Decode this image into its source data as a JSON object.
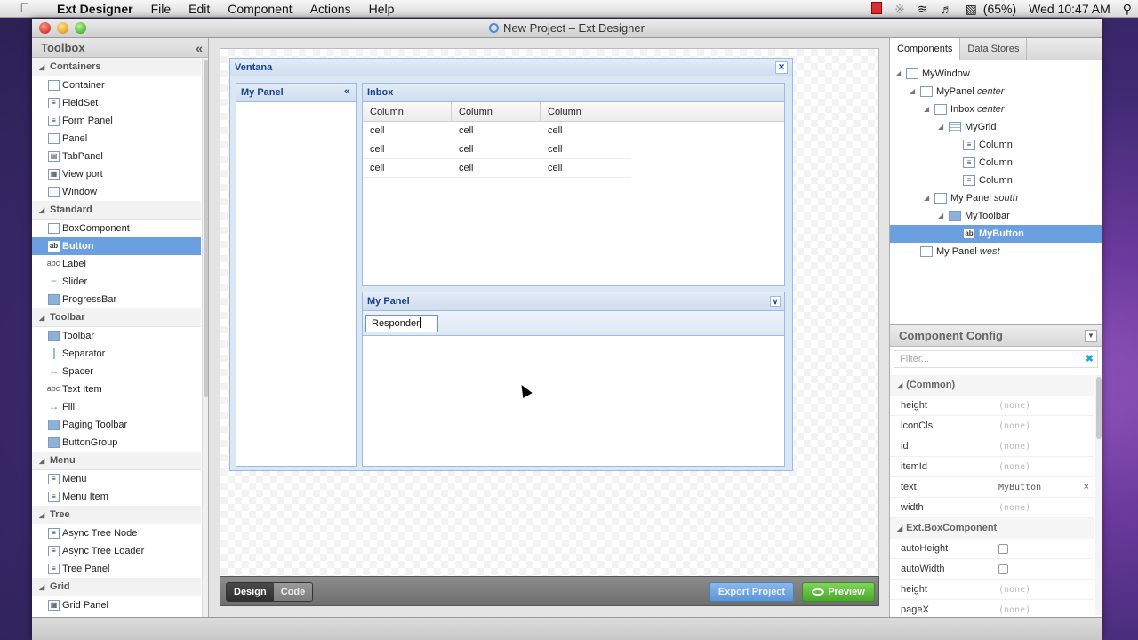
{
  "menubar": {
    "app_name": "Ext Designer",
    "items": [
      "File",
      "Edit",
      "Component",
      "Actions",
      "Help"
    ],
    "battery": "(65%)",
    "clock": "Wed 10:47 AM"
  },
  "window": {
    "title": "New Project – Ext Designer"
  },
  "toolbox": {
    "title": "Toolbox",
    "collapse_glyph": "«",
    "groups": [
      {
        "label": "Containers",
        "items": [
          "Container",
          "FieldSet",
          "Form Panel",
          "Panel",
          "TabPanel",
          "View port",
          "Window"
        ]
      },
      {
        "label": "Standard",
        "items": [
          "BoxComponent",
          "Button",
          "Label",
          "Slider",
          "ProgressBar"
        ]
      },
      {
        "label": "Toolbar",
        "items": [
          "Toolbar",
          "Separator",
          "Spacer",
          "Text Item",
          "Fill",
          "Paging Toolbar",
          "ButtonGroup"
        ]
      },
      {
        "label": "Menu",
        "items": [
          "Menu",
          "Menu Item"
        ]
      },
      {
        "label": "Tree",
        "items": [
          "Async Tree Node",
          "Async Tree Loader",
          "Tree Panel"
        ]
      },
      {
        "label": "Grid",
        "items": [
          "Grid Panel"
        ]
      }
    ],
    "selected": "Button"
  },
  "canvas": {
    "window_title": "Ventana",
    "west_panel_title": "My Panel",
    "inbox_title": "Inbox",
    "grid": {
      "columns": [
        "Column",
        "Column",
        "Column"
      ],
      "rows": [
        [
          "cell",
          "cell",
          "cell"
        ],
        [
          "cell",
          "cell",
          "cell"
        ],
        [
          "cell",
          "cell",
          "cell"
        ]
      ]
    },
    "south_panel_title": "My Panel",
    "toolbar_button_text": "Responder"
  },
  "bottom": {
    "design": "Design",
    "code": "Code",
    "export": "Export Project",
    "preview": "Preview"
  },
  "right": {
    "tabs": [
      "Components",
      "Data Stores"
    ],
    "tree": [
      {
        "label": "MyWindow",
        "region": ""
      },
      {
        "label": "MyPanel",
        "region": "center"
      },
      {
        "label": "Inbox",
        "region": "center"
      },
      {
        "label": "MyGrid",
        "region": ""
      },
      {
        "label": "Column",
        "region": ""
      },
      {
        "label": "Column",
        "region": ""
      },
      {
        "label": "Column",
        "region": ""
      },
      {
        "label": "My Panel",
        "region": "south"
      },
      {
        "label": "MyToolbar",
        "region": ""
      },
      {
        "label": "MyButton",
        "region": ""
      },
      {
        "label": "My Panel",
        "region": "west"
      }
    ],
    "config": {
      "title": "Component Config",
      "filter_placeholder": "Filter...",
      "groups": [
        {
          "label": "(Common)",
          "props": [
            {
              "key": "height",
              "value": "(none)"
            },
            {
              "key": "iconCls",
              "value": "(none)"
            },
            {
              "key": "id",
              "value": "(none)"
            },
            {
              "key": "itemId",
              "value": "(none)"
            },
            {
              "key": "text",
              "value": "MyButton"
            },
            {
              "key": "width",
              "value": "(none)"
            }
          ]
        },
        {
          "label": "Ext.BoxComponent",
          "props": [
            {
              "key": "autoHeight",
              "value": ""
            },
            {
              "key": "autoWidth",
              "value": ""
            },
            {
              "key": "height",
              "value": "(none)"
            },
            {
              "key": "pageX",
              "value": "(none)"
            }
          ]
        }
      ]
    }
  }
}
